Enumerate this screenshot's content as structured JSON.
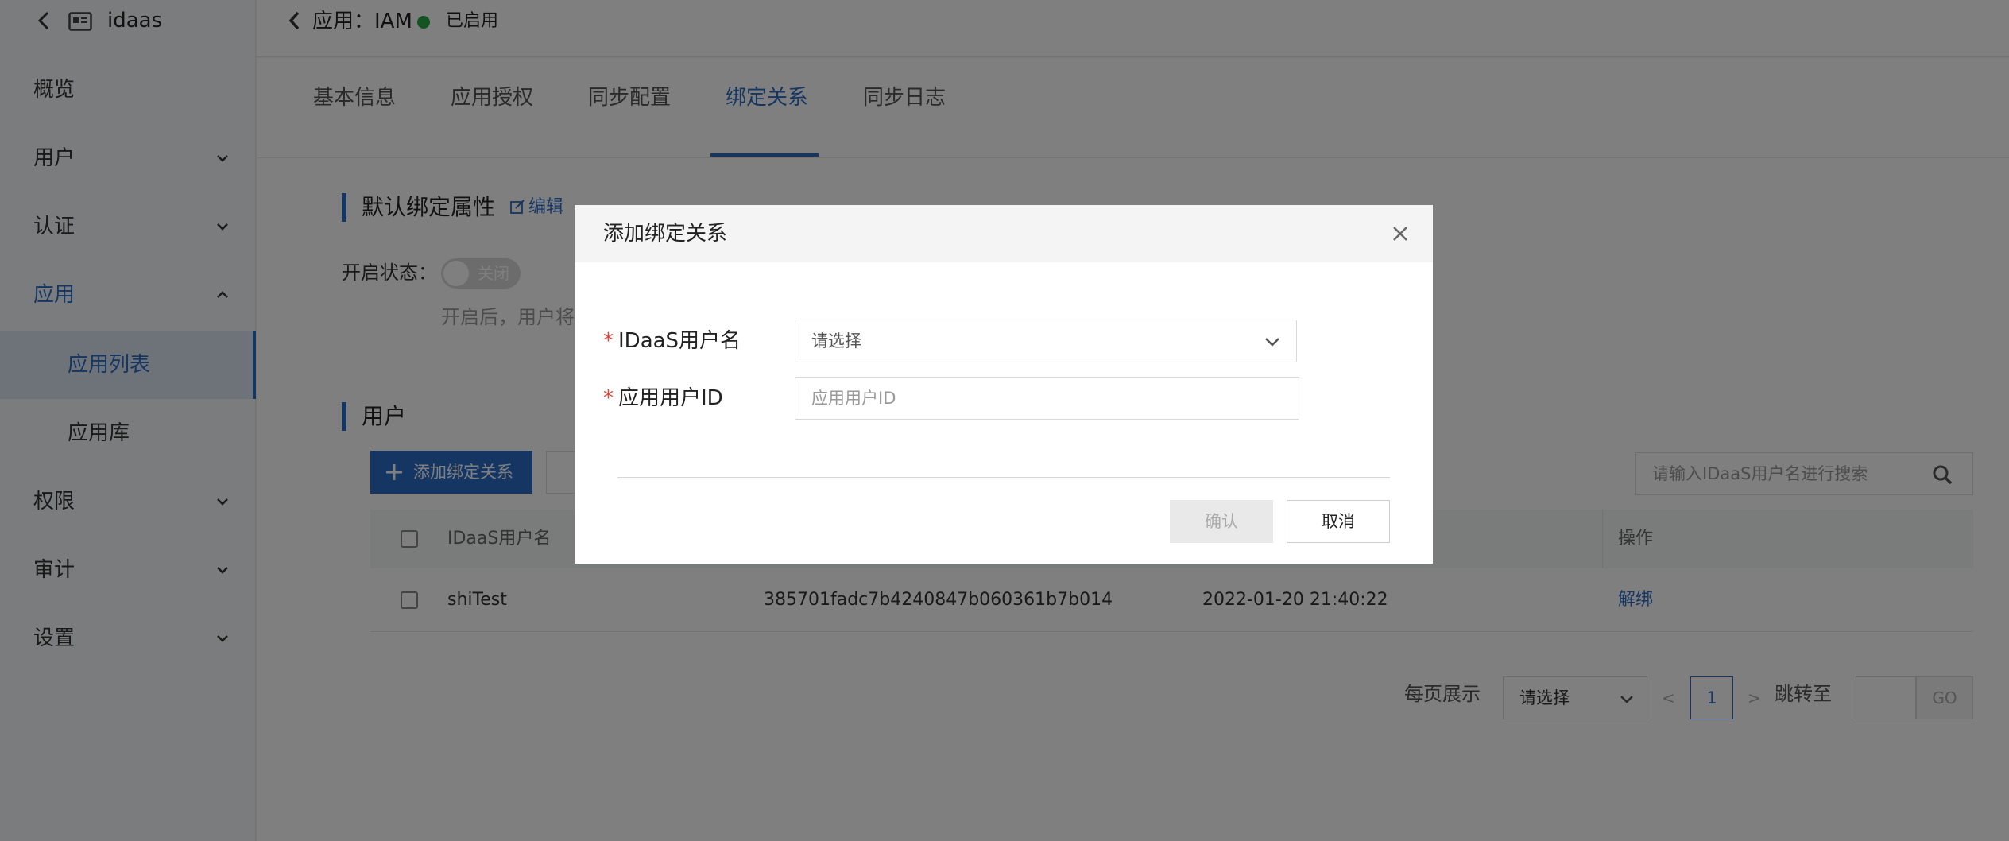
{
  "sidebar": {
    "app_name": "idaas",
    "items": [
      {
        "label": "概览"
      },
      {
        "label": "用户"
      },
      {
        "label": "认证"
      },
      {
        "label": "应用"
      },
      {
        "label": "应用列表"
      },
      {
        "label": "应用库"
      },
      {
        "label": "权限"
      },
      {
        "label": "审计"
      },
      {
        "label": "设置"
      }
    ]
  },
  "header": {
    "title": "应用：IAM",
    "status": "已启用",
    "status_color": "#29a745"
  },
  "tabs": [
    {
      "label": "基本信息"
    },
    {
      "label": "应用授权"
    },
    {
      "label": "同步配置"
    },
    {
      "label": "绑定关系",
      "active": true
    },
    {
      "label": "同步日志"
    }
  ],
  "binding_section": {
    "title": "默认绑定属性",
    "edit_label": "编辑",
    "toggle_label": "开启状态：",
    "toggle_text": "关闭",
    "toggle_on": false,
    "hint": "开启后，用户将"
  },
  "users_section": {
    "title": "用户",
    "add_button": "添加绑定关系",
    "search_placeholder": "请输入IDaaS用户名进行搜索",
    "columns": [
      "IDaaS用户名",
      "操作"
    ],
    "rows": [
      {
        "username": "shiTest",
        "id": "385701fadc7b4240847b060361b7b014",
        "time": "2022-01-20 21:40:22",
        "action": "解绑"
      }
    ]
  },
  "pagination": {
    "per_page_label": "每页展示",
    "per_page_value": "请选择",
    "prev": "<",
    "current_page": "1",
    "next": ">",
    "jump_label": "跳转至",
    "go_label": "GO"
  },
  "modal": {
    "title": "添加绑定关系",
    "required_mark": "*",
    "field1_label": "IDaaS用户名",
    "field1_placeholder": "请选择",
    "field2_label": "应用用户ID",
    "field2_placeholder": "应用用户ID",
    "confirm": "确认",
    "cancel": "取消"
  },
  "colors": {
    "accent": "#2b6cc4",
    "danger": "#e0453c"
  }
}
